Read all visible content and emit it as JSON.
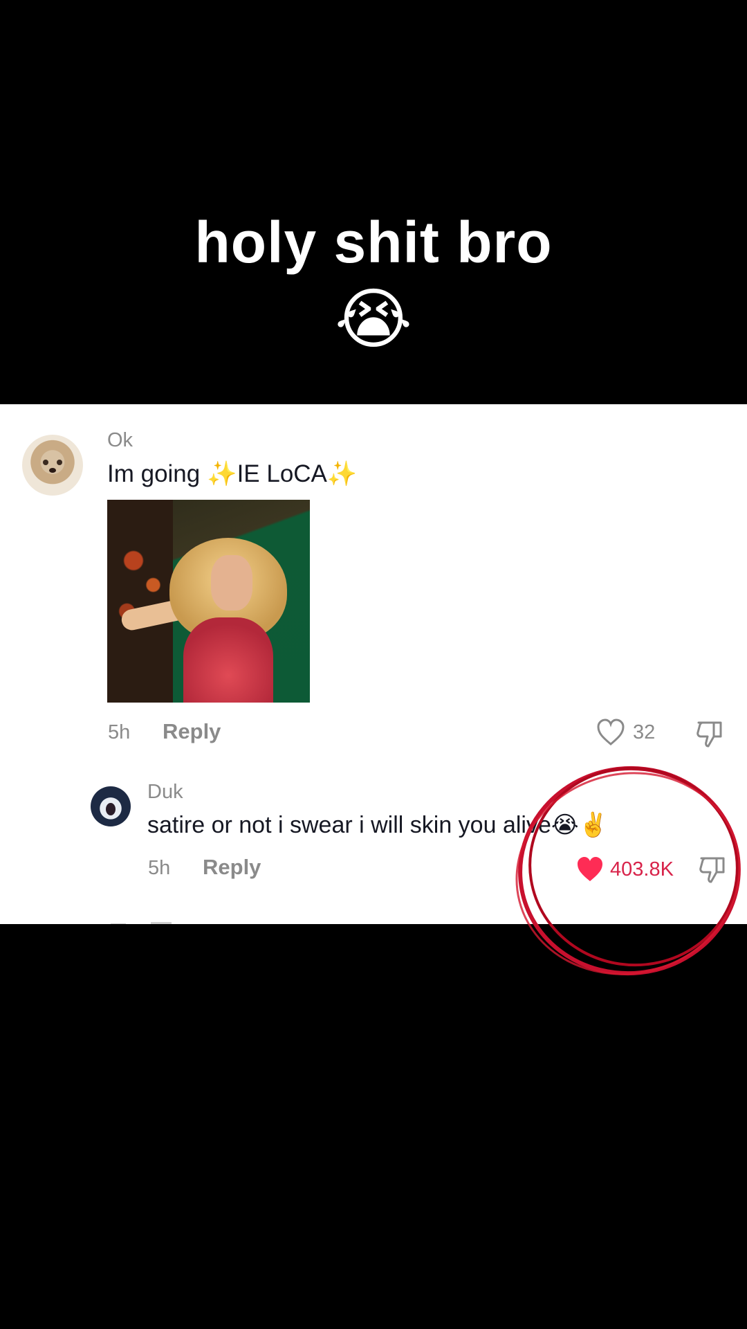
{
  "caption": {
    "text": "holy shit bro",
    "emoji": "😭"
  },
  "comments": [
    {
      "username": "Ok",
      "text_prefix": "Im going ",
      "sparkle_left": "✨",
      "text_middle": "IE LoCA",
      "sparkle_right": "✨",
      "time": "5h",
      "reply_label": "Reply",
      "likes": "32",
      "liked": false
    },
    {
      "username": "Duk",
      "text": "satire or not i swear i will skin you alive😭✌️",
      "time": "5h",
      "reply_label": "Reply",
      "likes": "403.8K",
      "liked": true
    }
  ],
  "colors": {
    "like_active": "#fe2c55",
    "annotation_circle": "#c8102e"
  },
  "icons": {
    "like": "heart-outline-icon",
    "like_active": "heart-filled-icon",
    "dislike": "thumbs-down-icon"
  }
}
